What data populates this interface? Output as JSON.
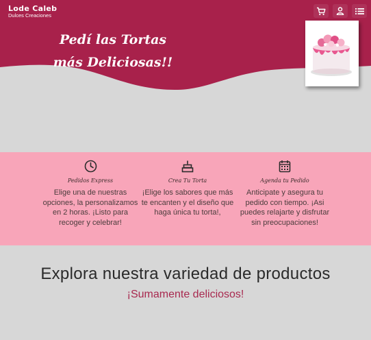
{
  "brand": {
    "name": "Lode Caleb",
    "tagline": "Dulces Creaciones"
  },
  "nav": {
    "icons": [
      "cart-icon",
      "user-icon",
      "menu-list-icon"
    ]
  },
  "hero": {
    "title_line1": "Pedí las Tortas",
    "title_line2": "más Deliciosas!!"
  },
  "colors": {
    "primary": "#a8214b",
    "features_bg": "#f8a5b9",
    "page_bg": "#d7d7d7"
  },
  "features": [
    {
      "icon": "clock-icon",
      "title": "Pedidos Express",
      "description": "Elige una de nuestras opciones, la personalizamos en 2 horas. ¡Listo para recoger y celebrar!"
    },
    {
      "icon": "cake-icon",
      "title": "Crea Tu Torta",
      "description": "¡Elige los sabores que más te encanten y el diseño que haga única tu torta!,"
    },
    {
      "icon": "calendar-icon",
      "title": "Agenda tu Pedido",
      "description": "Anticipate y asegura tu pedido con tiempo. ¡Asi puedes relajarte y disfrutar sin preocupaciones!"
    }
  ],
  "explore": {
    "title": "Explora nuestra variedad de productos",
    "subtitle": "¡Sumamente deliciosos!"
  }
}
